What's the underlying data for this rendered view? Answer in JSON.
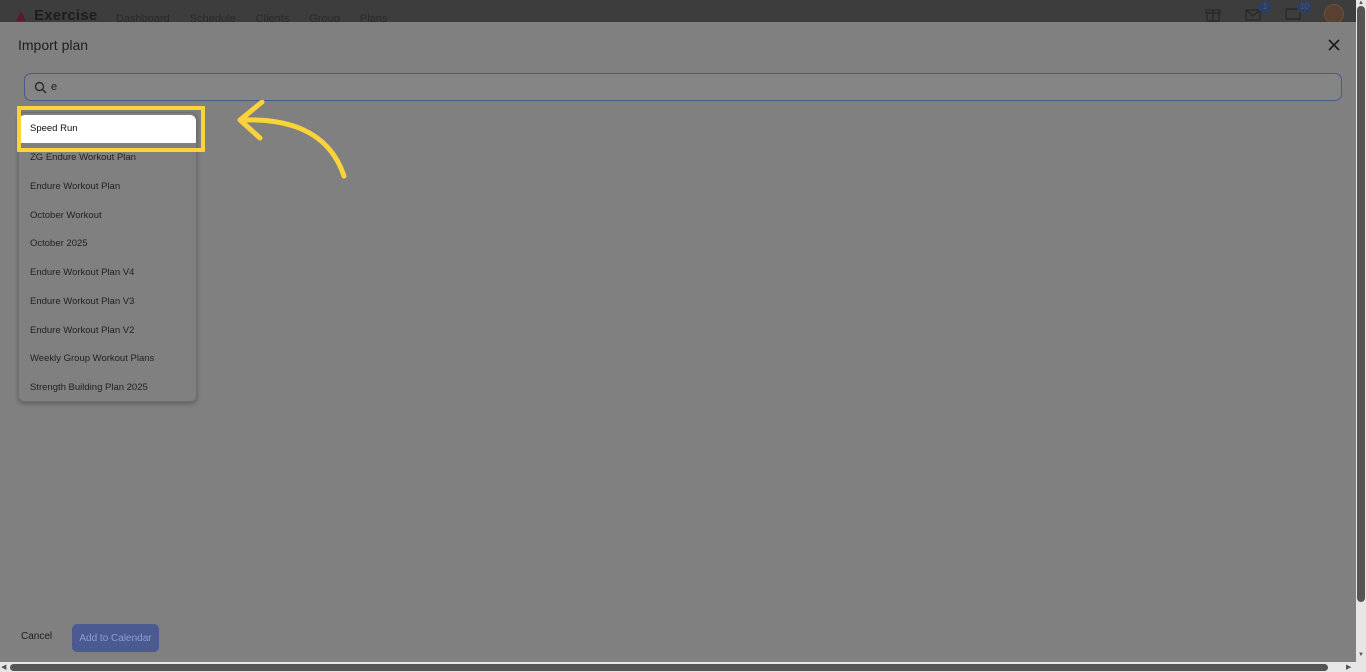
{
  "app": {
    "brand": "Exercise",
    "nav": [
      "Dashboard",
      "Schedule",
      "Clients",
      "Group",
      "Plans"
    ],
    "badges": {
      "mail": "1",
      "messages": "10"
    }
  },
  "modal": {
    "title": "Import plan",
    "search": {
      "value": "e",
      "placeholder": ""
    },
    "results": [
      "Speed Run",
      "ZG Endure Workout Plan",
      "Endure Workout Plan",
      "October Workout",
      "October 2025",
      "Endure Workout Plan V4",
      "Endure Workout Plan V3",
      "Endure Workout Plan V2",
      "Weekly Group Workout Plans",
      "Strength Building Plan 2025"
    ],
    "selected_result": "Speed Run",
    "cancel_label": "Cancel",
    "add_label": "Add to Calendar"
  },
  "annotation": {
    "highlight_color": "#fdd33a"
  },
  "icons": [
    "search-icon",
    "close-icon",
    "gift-icon",
    "mail-icon",
    "chat-icon",
    "arrow-annotation-icon"
  ]
}
